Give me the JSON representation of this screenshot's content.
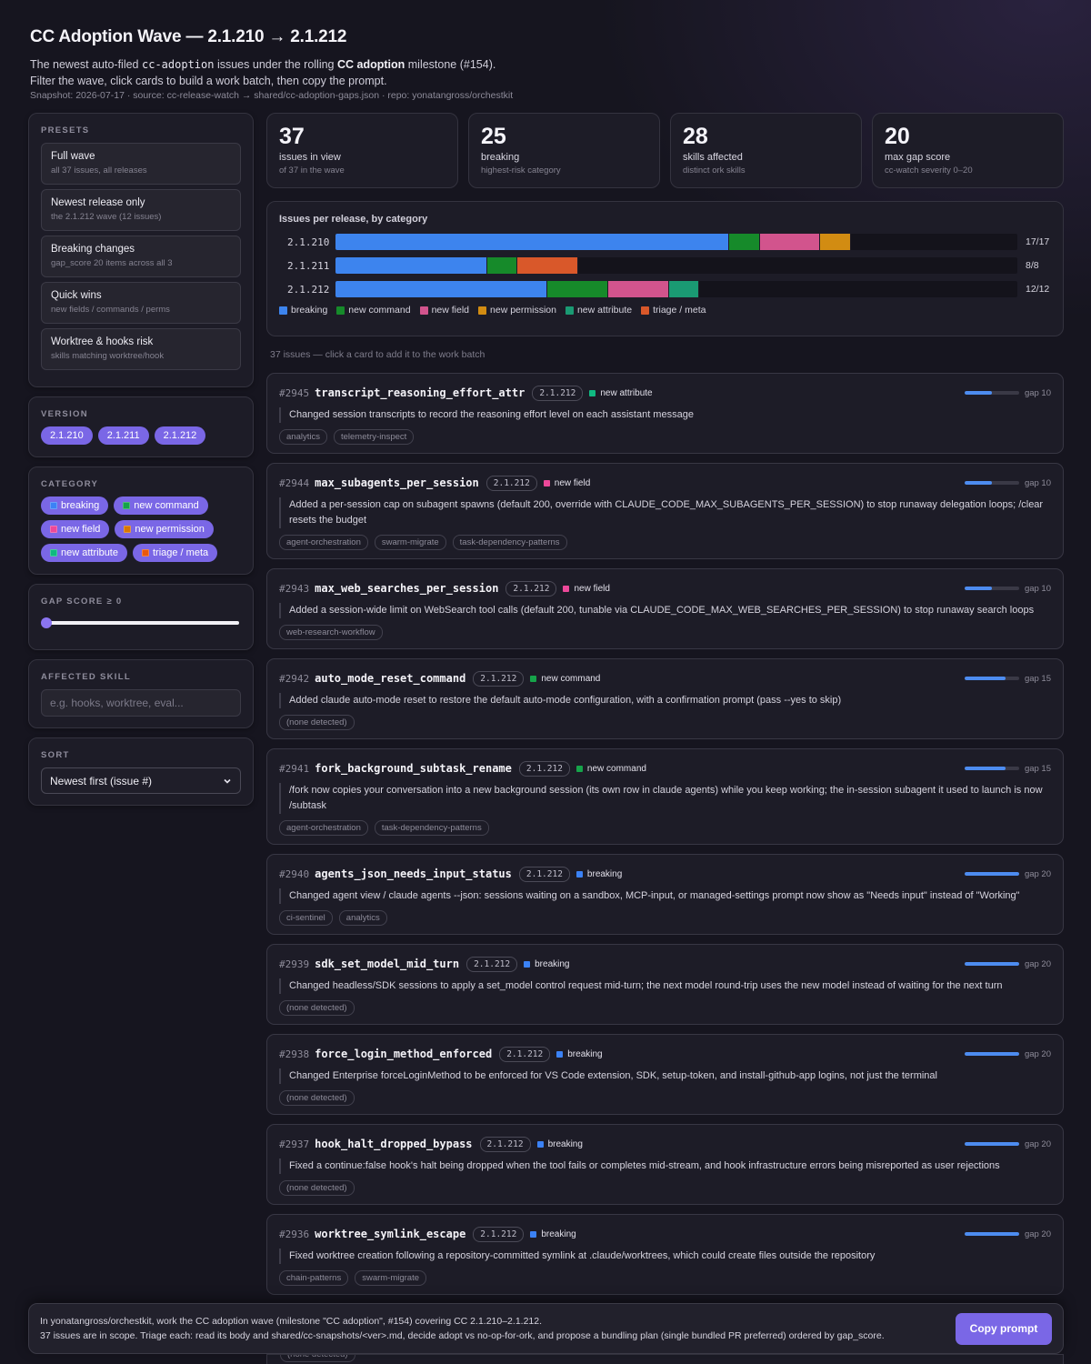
{
  "header": {
    "title": "CC Adoption Wave — 2.1.210 → 2.1.212",
    "sub_pre": "The newest auto-filed ",
    "sub_code": "cc-adoption",
    "sub_mid": " issues under the rolling ",
    "sub_bold": "CC adoption",
    "sub_post": " milestone (#154).",
    "sub_line2": "Filter the wave, click cards to build a work batch, then copy the prompt.",
    "snapshot": "Snapshot: 2026-07-17 · source: cc-release-watch → shared/cc-adoption-gaps.json · repo: yonatangross/orchestkit"
  },
  "sidebar": {
    "presets_title": "PRESETS",
    "presets": [
      {
        "title": "Full wave",
        "desc": "all 37 issues, all releases"
      },
      {
        "title": "Newest release only",
        "desc": "the 2.1.212 wave (12 issues)"
      },
      {
        "title": "Breaking changes",
        "desc": "gap_score 20 items across all 3"
      },
      {
        "title": "Quick wins",
        "desc": "new fields / commands / perms"
      },
      {
        "title": "Worktree & hooks risk",
        "desc": "skills matching worktree/hook"
      }
    ],
    "version_title": "VERSION",
    "versions": [
      "2.1.210",
      "2.1.211",
      "2.1.212"
    ],
    "category_title": "CATEGORY",
    "categories": [
      {
        "label": "breaking",
        "color": "#3b82f6"
      },
      {
        "label": "new command",
        "color": "#16a34a"
      },
      {
        "label": "new field",
        "color": "#ec4899"
      },
      {
        "label": "new permission",
        "color": "#d97706"
      },
      {
        "label": "new attribute",
        "color": "#10b981"
      },
      {
        "label": "triage / meta",
        "color": "#ea580c"
      }
    ],
    "gap_title": "GAP SCORE ≥ 0",
    "gap_min": 0,
    "skill_title": "AFFECTED SKILL",
    "skill_placeholder": "e.g. hooks, worktree, eval...",
    "sort_title": "SORT",
    "sort_value": "Newest first (issue #)"
  },
  "stats": [
    {
      "n": "37",
      "l": "issues in view",
      "s": "of 37 in the wave"
    },
    {
      "n": "25",
      "l": "breaking",
      "s": "highest-risk category"
    },
    {
      "n": "28",
      "l": "skills affected",
      "s": "distinct ork skills"
    },
    {
      "n": "20",
      "l": "max gap score",
      "s": "cc-watch severity 0–20"
    }
  ],
  "chart_data": {
    "type": "bar",
    "title": "Issues per release, by category",
    "categories": [
      "2.1.210",
      "2.1.211",
      "2.1.212"
    ],
    "scale_max": 22.5,
    "series": [
      {
        "name": "breaking",
        "color": "#3d84ee",
        "values": [
          13,
          5,
          7
        ]
      },
      {
        "name": "new command",
        "color": "#168a2a",
        "values": [
          1,
          1,
          2
        ]
      },
      {
        "name": "new field",
        "color": "#d2548d",
        "values": [
          2,
          0,
          2
        ]
      },
      {
        "name": "new permission",
        "color": "#d28c12",
        "values": [
          1,
          0,
          0
        ]
      },
      {
        "name": "new attribute",
        "color": "#1a9a73",
        "values": [
          0,
          0,
          1
        ]
      },
      {
        "name": "triage / meta",
        "color": "#d9582a",
        "values": [
          0,
          2,
          0
        ]
      }
    ],
    "totals": [
      "17/17",
      "8/8",
      "12/12"
    ]
  },
  "list_hint": "37 issues — click a card to add it to the work batch",
  "issues": [
    {
      "num": "#2945",
      "title": "transcript_reasoning_effort_attr",
      "ver": "2.1.212",
      "cat": "new attribute",
      "cat_color": "#10b981",
      "gap": 10,
      "gap_label": "gap 10",
      "desc": "Changed session transcripts to record the reasoning effort level on each assistant message",
      "tags": [
        "analytics",
        "telemetry-inspect"
      ]
    },
    {
      "num": "#2944",
      "title": "max_subagents_per_session",
      "ver": "2.1.212",
      "cat": "new field",
      "cat_color": "#ec4899",
      "gap": 10,
      "gap_label": "gap 10",
      "desc": "Added a per-session cap on subagent spawns (default 200, override with CLAUDE_CODE_MAX_SUBAGENTS_PER_SESSION) to stop runaway delegation loops; /clear resets the budget",
      "tags": [
        "agent-orchestration",
        "swarm-migrate",
        "task-dependency-patterns"
      ]
    },
    {
      "num": "#2943",
      "title": "max_web_searches_per_session",
      "ver": "2.1.212",
      "cat": "new field",
      "cat_color": "#ec4899",
      "gap": 10,
      "gap_label": "gap 10",
      "desc": "Added a session-wide limit on WebSearch tool calls (default 200, tunable via CLAUDE_CODE_MAX_WEB_SEARCHES_PER_SESSION) to stop runaway search loops",
      "tags": [
        "web-research-workflow"
      ]
    },
    {
      "num": "#2942",
      "title": "auto_mode_reset_command",
      "ver": "2.1.212",
      "cat": "new command",
      "cat_color": "#16a34a",
      "gap": 15,
      "gap_label": "gap 15",
      "desc": "Added claude auto-mode reset to restore the default auto-mode configuration, with a confirmation prompt (pass --yes to skip)",
      "tags": [
        "(none detected)"
      ]
    },
    {
      "num": "#2941",
      "title": "fork_background_subtask_rename",
      "ver": "2.1.212",
      "cat": "new command",
      "cat_color": "#16a34a",
      "gap": 15,
      "gap_label": "gap 15",
      "desc": "/fork now copies your conversation into a new background session (its own row in claude agents) while you keep working; the in-session subagent it used to launch is now /subtask",
      "tags": [
        "agent-orchestration",
        "task-dependency-patterns"
      ]
    },
    {
      "num": "#2940",
      "title": "agents_json_needs_input_status",
      "ver": "2.1.212",
      "cat": "breaking",
      "cat_color": "#3b82f6",
      "gap": 20,
      "gap_label": "gap 20",
      "desc": "Changed agent view / claude agents --json: sessions waiting on a sandbox, MCP-input, or managed-settings prompt now show as \"Needs input\" instead of \"Working\"",
      "tags": [
        "ci-sentinel",
        "analytics"
      ]
    },
    {
      "num": "#2939",
      "title": "sdk_set_model_mid_turn",
      "ver": "2.1.212",
      "cat": "breaking",
      "cat_color": "#3b82f6",
      "gap": 20,
      "gap_label": "gap 20",
      "desc": "Changed headless/SDK sessions to apply a set_model control request mid-turn; the next model round-trip uses the new model instead of waiting for the next turn",
      "tags": [
        "(none detected)"
      ]
    },
    {
      "num": "#2938",
      "title": "force_login_method_enforced",
      "ver": "2.1.212",
      "cat": "breaking",
      "cat_color": "#3b82f6",
      "gap": 20,
      "gap_label": "gap 20",
      "desc": "Changed Enterprise forceLoginMethod to be enforced for VS Code extension, SDK, setup-token, and install-github-app logins, not just the terminal",
      "tags": [
        "(none detected)"
      ]
    },
    {
      "num": "#2937",
      "title": "hook_halt_dropped_bypass",
      "ver": "2.1.212",
      "cat": "breaking",
      "cat_color": "#3b82f6",
      "gap": 20,
      "gap_label": "gap 20",
      "desc": "Fixed a continue:false hook's halt being dropped when the tool fails or completes mid-stream, and hook infrastructure errors being misreported as user rejections",
      "tags": [
        "(none detected)"
      ]
    },
    {
      "num": "#2936",
      "title": "worktree_symlink_escape",
      "ver": "2.1.212",
      "cat": "breaking",
      "cat_color": "#3b82f6",
      "gap": 20,
      "gap_label": "gap 20",
      "desc": "Fixed worktree creation following a repository-committed symlink at .claude/worktrees, which could create files outside the repository",
      "tags": [
        "chain-patterns",
        "swarm-migrate"
      ]
    }
  ],
  "peek_tag": "(none detected)",
  "footer": {
    "line1": "In yonatangross/orchestkit, work the CC adoption wave (milestone \"CC adoption\", #154) covering CC 2.1.210–2.1.212.",
    "line2": "37 issues are in scope. Triage each: read its body and shared/cc-snapshots/<ver>.md, decide adopt vs no-op-for-ork, and propose a bundling plan (single bundled PR preferred) ordered by gap_score.",
    "button": "Copy prompt"
  }
}
